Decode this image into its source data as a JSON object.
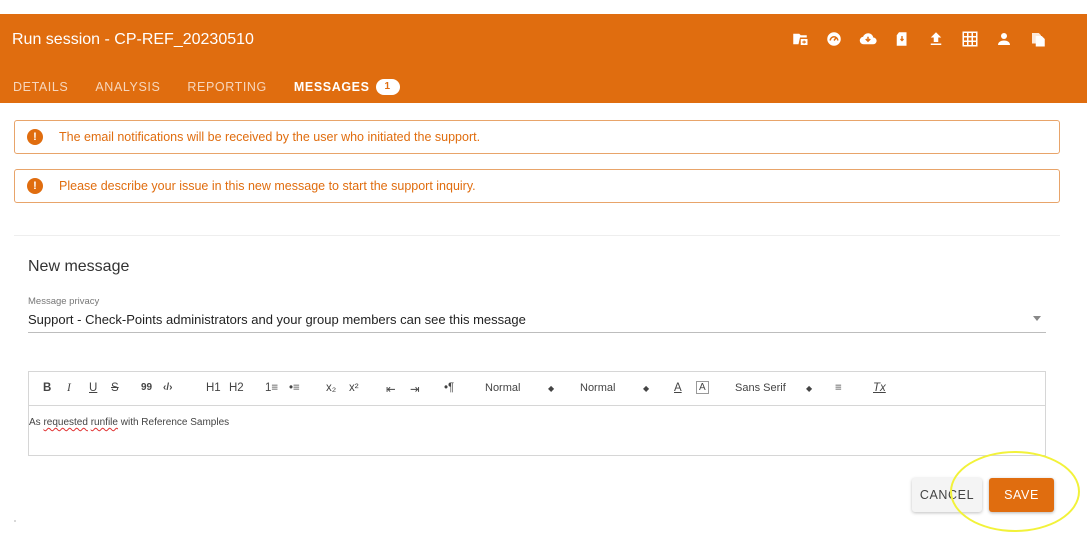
{
  "header": {
    "title": "Run session - CP-REF_20230510",
    "background_color": "#E06D0F",
    "icons": [
      "run-file-icon",
      "speedometer-icon",
      "cloud-download-icon",
      "sd-card-icon",
      "upload-icon",
      "grid-icon",
      "person-icon",
      "copy-files-icon"
    ]
  },
  "tabs": [
    {
      "label": "DETAILS"
    },
    {
      "label": "ANALYSIS"
    },
    {
      "label": "REPORTING"
    },
    {
      "label": "MESSAGES",
      "badge": "1",
      "active": true
    }
  ],
  "alerts": [
    {
      "icon": "!",
      "text": "The email notifications will be received by the user who initiated the support."
    },
    {
      "icon": "!",
      "text": "Please describe your issue in this new message to start the support inquiry."
    }
  ],
  "new_message": {
    "title": "New message",
    "privacy_label": "Message privacy",
    "privacy_value": "Support - Check-Points administrators and your group members can see this message"
  },
  "editor": {
    "toolbar": {
      "bold": "B",
      "italic": "I",
      "underline": "U",
      "strike": "S",
      "blockquote": "99",
      "code": "‹/›",
      "h1": "H1",
      "h2": "H2",
      "ordered_list": "1≡",
      "bullet_list": "•≡",
      "subscript": "x₂",
      "superscript": "x²",
      "outdent": "⇤",
      "indent": "⇥",
      "direction": "•¶",
      "size_picker": "Normal",
      "header_picker": "Normal",
      "font_color": "A",
      "background_color": "A",
      "font_picker": "Sans Serif",
      "align": "≡",
      "clean": "Tx"
    },
    "content_parts": [
      "As ",
      "requested",
      " ",
      "runfile",
      " with Reference Samples"
    ]
  },
  "buttons": {
    "cancel": "CANCEL",
    "save": "SAVE"
  },
  "highlight_color": "#F2F23A"
}
